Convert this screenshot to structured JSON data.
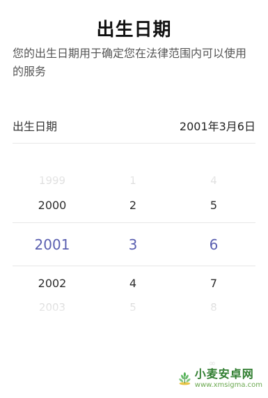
{
  "page": {
    "title": "出生日期",
    "subtitle": "您的出生日期用于确定您在法律范围内可以使用的服务"
  },
  "birthday_row": {
    "label": "出生日期",
    "value": "2001年3月6日"
  },
  "picker": {
    "selected_color": "#5a5fb0",
    "years": [
      "1999",
      "2000",
      "2001",
      "2002",
      "2003"
    ],
    "months": [
      "1",
      "2",
      "3",
      "4",
      "5"
    ],
    "days": [
      "4",
      "5",
      "6",
      "7",
      "8"
    ]
  },
  "watermark": {
    "name": "小麦安卓网",
    "url": "www.xmsigma.com",
    "icon": "wheat-logo-icon"
  },
  "faint_mark": "∞"
}
